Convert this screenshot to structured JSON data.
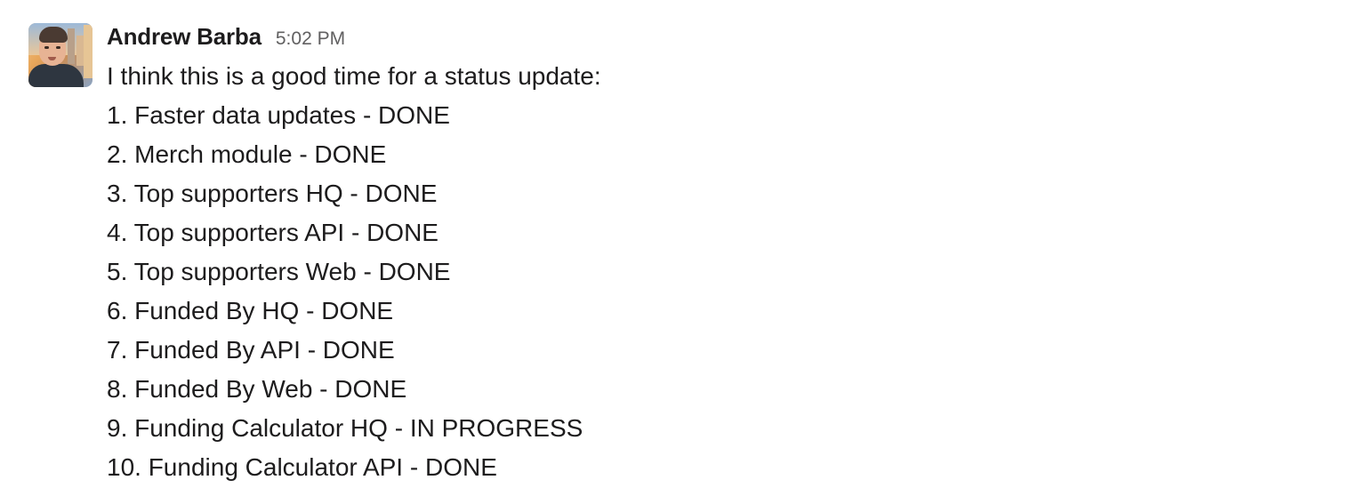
{
  "message": {
    "sender": "Andrew Barba",
    "timestamp": "5:02 PM",
    "avatar_icon": "user-avatar-photo",
    "intro": "I think this is a good time for a status update:",
    "items": [
      "1. Faster data updates - DONE",
      "2. Merch module - DONE",
      "3. Top supporters HQ - DONE",
      "4. Top supporters API - DONE",
      "5. Top supporters Web - DONE",
      "6. Funded By HQ - DONE",
      "7. Funded By API - DONE",
      "8. Funded By Web - DONE",
      "9. Funding Calculator HQ - IN PROGRESS",
      "10. Funding Calculator API - DONE"
    ]
  }
}
